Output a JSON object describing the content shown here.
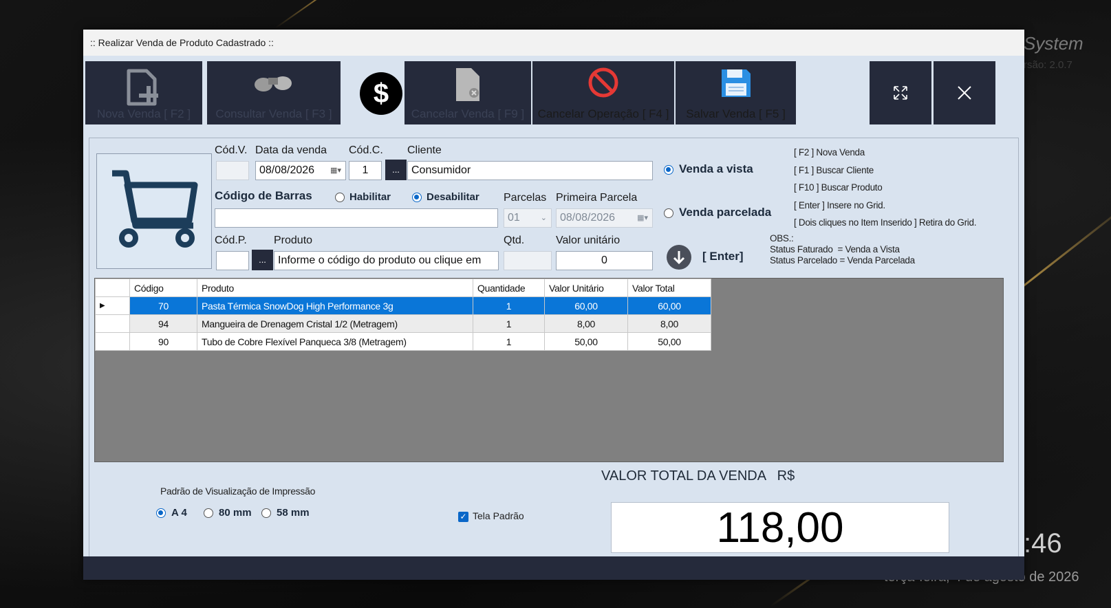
{
  "desktop": {
    "brand": "System",
    "version": "rsão: 2.0.7",
    "clock": ":46",
    "date": "terça-feira, 4 de agosto de 2026"
  },
  "window": {
    "title": ":: Realizar Venda de Produto Cadastrado ::"
  },
  "toolbar": {
    "nova": "Nova Venda [ F2 ]",
    "consultar": "Consultar Venda [ F3 ]",
    "dollar": "$",
    "cancelar_venda": "Cancelar Venda [ F9 ]",
    "cancelar_operacao": "Cancelar Operação [ F4 ]",
    "salvar": "Salvar Venda [ F5 ]"
  },
  "form": {
    "codv_label": "Cód.V.",
    "codv_value": "",
    "data_label": "Data da venda",
    "data_value": "08/08/2026",
    "codc_label": "Cód.C.",
    "codc_value": "1",
    "cliente_label": "Cliente",
    "cliente_value": "Consumidor",
    "browse": "...",
    "barras_label": "Código de Barras",
    "habilitar": "Habilitar",
    "desabilitar": "Desabilitar",
    "barras_value": "",
    "parcelas_label": "Parcelas",
    "parcelas_value": "01",
    "primeira_label": "Primeira Parcela",
    "primeira_value": "08/08/2026",
    "codp_label": "Cód.P.",
    "codp_value": "",
    "produto_label": "Produto",
    "produto_value": "Informe o código do produto ou clique em",
    "qtd_label": "Qtd.",
    "qtd_value": "",
    "valor_label": "Valor unitário",
    "valor_value": "0",
    "venda_vista": "Venda a vista",
    "venda_parcelada": "Venda parcelada",
    "enter_label": "[ Enter]"
  },
  "shortcuts": [
    "[ F2 ] Nova Venda",
    "[ F1 ] Buscar Cliente",
    "[ F10 ] Buscar Produto",
    "[ Enter ] Insere no Grid.",
    "[ Dois cliques no Item Inserido ] Retira do Grid."
  ],
  "obs": {
    "title": "OBS.:",
    "line1": "Status Faturado  = Venda a Vista",
    "line2": "Status Parcelado = Venda Parcelada"
  },
  "grid": {
    "headers": [
      "Código",
      "Produto",
      "Quantidade",
      "Valor Unitário",
      "Valor Total"
    ],
    "rows": [
      {
        "codigo": "70",
        "produto": "Pasta Térmica SnowDog High Performance 3g",
        "qtd": "1",
        "unit": "60,00",
        "total": "60,00"
      },
      {
        "codigo": "94",
        "produto": "Mangueira de Drenagem Cristal 1/2 (Metragem)",
        "qtd": "1",
        "unit": "8,00",
        "total": "8,00"
      },
      {
        "codigo": "90",
        "produto": "Tubo de Cobre Flexível Panqueca 3/8 (Metragem)",
        "qtd": "1",
        "unit": "50,00",
        "total": "50,00"
      }
    ]
  },
  "footer": {
    "impressao_label": "Padrão de Visualização de Impressão",
    "opt_a4": "A 4",
    "opt_80": "80 mm",
    "opt_58": "58 mm",
    "tela_padrao": "Tela Padrão",
    "total_label": "VALOR TOTAL DA VENDA   R$",
    "total_value": "118,00"
  }
}
